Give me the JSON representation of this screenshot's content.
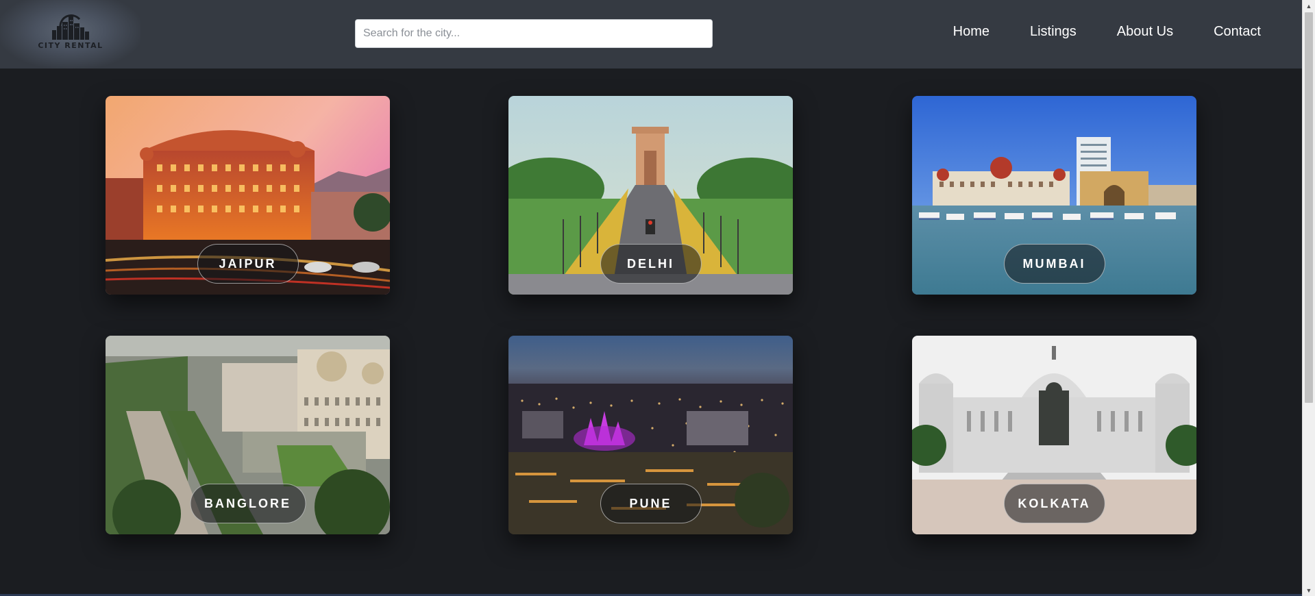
{
  "brand": {
    "name": "CITY RENTAL",
    "icon": "city-skyline-logo"
  },
  "search": {
    "placeholder": "Search for the city..."
  },
  "nav": {
    "items": [
      {
        "label": "Home"
      },
      {
        "label": "Listings"
      },
      {
        "label": "About Us"
      },
      {
        "label": "Contact"
      }
    ]
  },
  "cities": [
    {
      "name": "JAIPUR"
    },
    {
      "name": "DELHI"
    },
    {
      "name": "MUMBAI"
    },
    {
      "name": "BANGLORE"
    },
    {
      "name": "PUNE"
    },
    {
      "name": "KOLKATA"
    }
  ],
  "colors": {
    "header_bg": "#353a42",
    "page_bg": "#1b1d21",
    "nav_text": "#ffffff",
    "label_bg": "rgba(20,22,26,0.55)"
  }
}
